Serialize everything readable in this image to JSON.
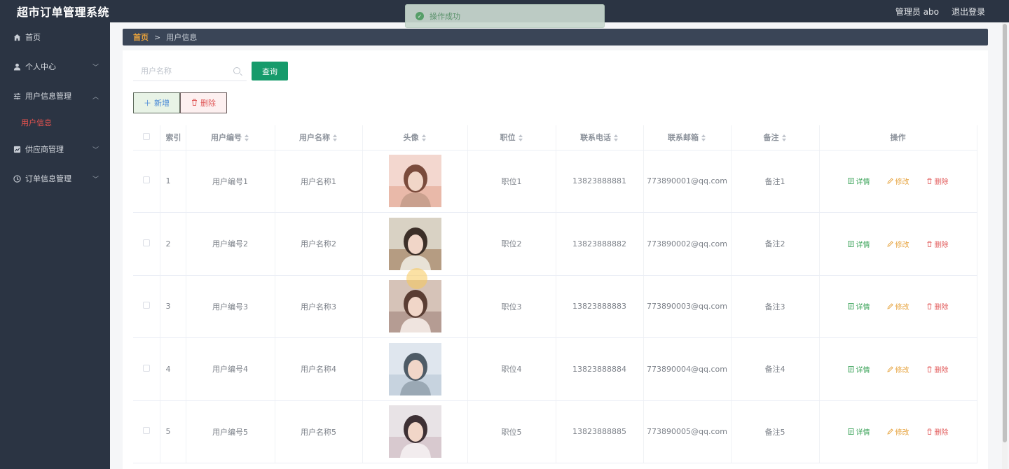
{
  "app": {
    "title": "超市订单管理系统"
  },
  "header": {
    "user_label": "管理员 abo",
    "logout_label": "退出登录"
  },
  "toast": {
    "message": "操作成功"
  },
  "sidebar": {
    "items": [
      {
        "label": "首页",
        "icon": "home-icon"
      },
      {
        "label": "个人中心",
        "icon": "user-icon"
      },
      {
        "label": "用户信息管理",
        "icon": "sliders-icon"
      },
      {
        "label": "供应商管理",
        "icon": "chart-icon"
      },
      {
        "label": "订单信息管理",
        "icon": "clock-icon"
      }
    ],
    "sub_item": {
      "label": "用户信息"
    }
  },
  "breadcrumb": {
    "home": "首页",
    "separator": ">",
    "current": "用户信息"
  },
  "search": {
    "placeholder": "用户名称",
    "button": "查询"
  },
  "actions": {
    "add": "新增",
    "delete": "删除"
  },
  "table": {
    "headers": {
      "index": "索引",
      "user_no": "用户编号",
      "user_name": "用户名称",
      "avatar": "头像",
      "position": "职位",
      "phone": "联系电话",
      "email": "联系邮箱",
      "note": "备注",
      "ops": "操作"
    },
    "row_actions": {
      "detail": "详情",
      "edit": "修改",
      "delete": "删除"
    },
    "rows": [
      {
        "index": "1",
        "user_no": "用户编号1",
        "user_name": "用户名称1",
        "position": "职位1",
        "phone": "13823888881",
        "email": "773890001@qq.com",
        "note": "备注1"
      },
      {
        "index": "2",
        "user_no": "用户编号2",
        "user_name": "用户名称2",
        "position": "职位2",
        "phone": "13823888882",
        "email": "773890002@qq.com",
        "note": "备注2"
      },
      {
        "index": "3",
        "user_no": "用户编号3",
        "user_name": "用户名称3",
        "position": "职位3",
        "phone": "13823888883",
        "email": "773890003@qq.com",
        "note": "备注3"
      },
      {
        "index": "4",
        "user_no": "用户编号4",
        "user_name": "用户名称4",
        "position": "职位4",
        "phone": "13823888884",
        "email": "773890004@qq.com",
        "note": "备注4"
      },
      {
        "index": "5",
        "user_no": "用户编号5",
        "user_name": "用户名称5",
        "position": "职位5",
        "phone": "13823888885",
        "email": "773890005@qq.com",
        "note": "备注5"
      }
    ]
  },
  "colors": {
    "sidebar_bg": "#2b3443",
    "accent_green": "#169b6b",
    "active_red": "#e8534f",
    "breadcrumb_home": "#e9a23b"
  }
}
